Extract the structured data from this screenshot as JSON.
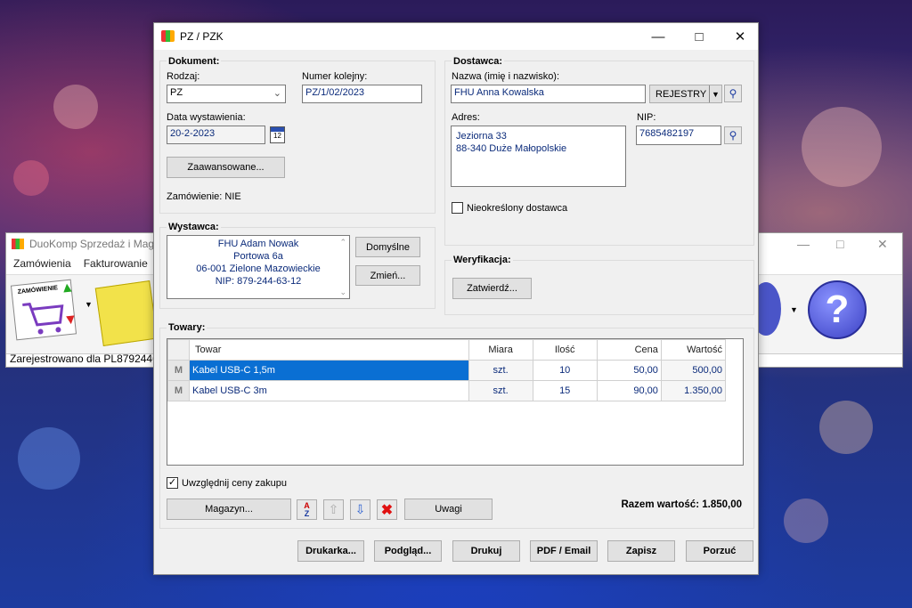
{
  "bg_window": {
    "title": "DuoKomp Sprzedaż i Maga",
    "menu": [
      "Zamówienia",
      "Fakturowanie"
    ],
    "status": "Zarejestrowano dla PL87924463",
    "tool_label": "ZAMÓWIENIE"
  },
  "dialog": {
    "title": "PZ / PZK",
    "dokument": {
      "header": "Dokument:",
      "rodzaj_label": "Rodzaj:",
      "rodzaj_value": "PZ",
      "numer_label": "Numer kolejny:",
      "numer_value": "PZ/1/02/2023",
      "data_label": "Data wystawienia:",
      "data_value": "20-2-2023",
      "calendar_day": "12",
      "advanced_button": "Zaawansowane...",
      "order_status": "Zamówienie: NIE"
    },
    "dostawca": {
      "header": "Dostawca:",
      "nazwa_label": "Nazwa (imię i nazwisko):",
      "nazwa_value": "FHU Anna Kowalska",
      "rejestry_button": "REJESTRY",
      "adres_label": "Adres:",
      "adres_line1": "Jeziorna 33",
      "adres_line2": "88-340 Duże Małopolskie",
      "nip_label": "NIP:",
      "nip_value": "7685482197",
      "undefined_label": "Nieokreślony dostawca"
    },
    "wystawca": {
      "header": "Wystawca:",
      "line1": "FHU Adam Nowak",
      "line2": "Portowa 6a",
      "line3": "06-001 Zielone Mazowieckie",
      "line4": "NIP: 879-244-63-12",
      "default_button": "Domyślne",
      "change_button": "Zmień..."
    },
    "weryfikacja": {
      "header": "Weryfikacja:",
      "confirm_button": "Zatwierdź..."
    },
    "towary": {
      "header": "Towary:",
      "columns": [
        "Towar",
        "Miara",
        "Ilość",
        "Cena",
        "Wartość"
      ],
      "rows": [
        {
          "flag": "M",
          "name": "Kabel USB-C 1,5m",
          "unit": "szt.",
          "qty": "10",
          "price": "50,00",
          "value": "500,00"
        },
        {
          "flag": "M",
          "name": "Kabel USB-C 3m",
          "unit": "szt.",
          "qty": "15",
          "price": "90,00",
          "value": "1.350,00"
        }
      ],
      "purchase_prices_label": "Uwzględnij ceny zakupu",
      "magazyn_button": "Magazyn...",
      "uwagi_button": "Uwagi",
      "total": "Razem wartość: 1.850,00"
    },
    "footer": {
      "drukarka": "Drukarka...",
      "podglad": "Podgląd...",
      "drukuj": "Drukuj",
      "pdf": "PDF / Email",
      "zapisz": "Zapisz",
      "porzuc": "Porzuć"
    }
  }
}
